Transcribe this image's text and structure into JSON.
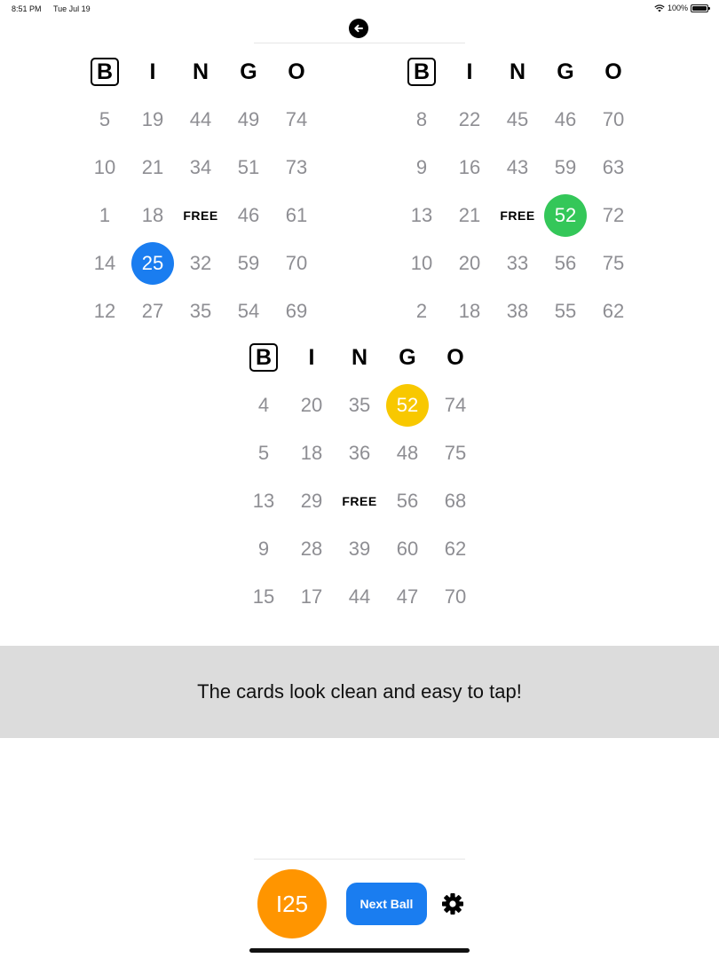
{
  "status_bar": {
    "time": "8:51 PM",
    "date": "Tue Jul 19",
    "battery": "100%"
  },
  "toolbar": {
    "back_icon": "arrow-left-circle-icon"
  },
  "cards": [
    {
      "headers": [
        "B",
        "I",
        "N",
        "G",
        "O"
      ],
      "rows": [
        [
          "5",
          "19",
          "44",
          "49",
          "74"
        ],
        [
          "10",
          "21",
          "34",
          "51",
          "73"
        ],
        [
          "1",
          "18",
          "FREE",
          "46",
          "61"
        ],
        [
          "14",
          "25",
          "32",
          "59",
          "70"
        ],
        [
          "12",
          "27",
          "35",
          "54",
          "69"
        ]
      ],
      "marked": [
        {
          "row": 3,
          "col": 1,
          "color": "#1a7df0"
        }
      ]
    },
    {
      "headers": [
        "B",
        "I",
        "N",
        "G",
        "O"
      ],
      "rows": [
        [
          "8",
          "22",
          "45",
          "46",
          "70"
        ],
        [
          "9",
          "16",
          "43",
          "59",
          "63"
        ],
        [
          "13",
          "21",
          "FREE",
          "52",
          "72"
        ],
        [
          "10",
          "20",
          "33",
          "56",
          "75"
        ],
        [
          "2",
          "18",
          "38",
          "55",
          "62"
        ]
      ],
      "marked": [
        {
          "row": 2,
          "col": 3,
          "color": "#34c759"
        }
      ]
    },
    {
      "headers": [
        "B",
        "I",
        "N",
        "G",
        "O"
      ],
      "rows": [
        [
          "4",
          "20",
          "35",
          "52",
          "74"
        ],
        [
          "5",
          "18",
          "36",
          "48",
          "75"
        ],
        [
          "13",
          "29",
          "FREE",
          "56",
          "68"
        ],
        [
          "9",
          "28",
          "39",
          "60",
          "62"
        ],
        [
          "15",
          "17",
          "44",
          "47",
          "70"
        ]
      ],
      "marked": [
        {
          "row": 0,
          "col": 3,
          "color": "#f8c800"
        }
      ]
    }
  ],
  "message": "The cards look clean and easy to tap!",
  "controls": {
    "current_ball": "I25",
    "ball_color": "#ff9500",
    "next_ball_label": "Next Ball",
    "settings_icon": "gear-icon"
  }
}
